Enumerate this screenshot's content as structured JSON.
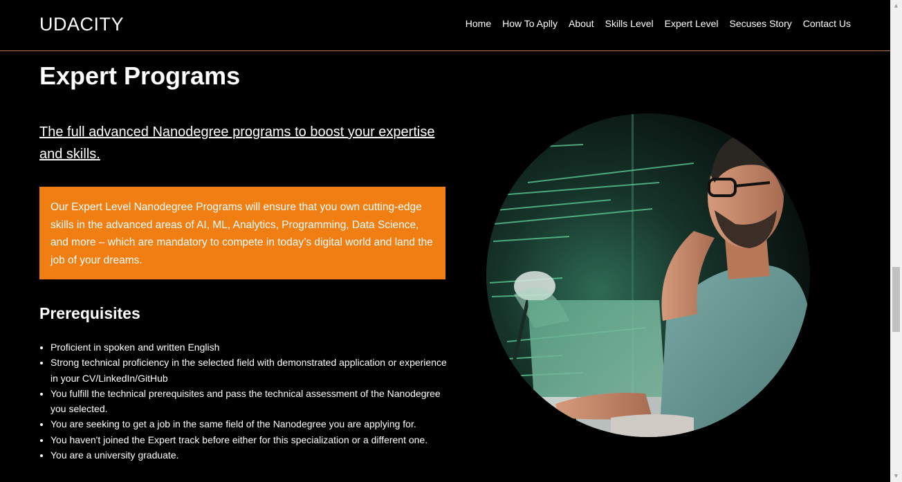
{
  "header": {
    "brand": "UDACITY",
    "nav": [
      "Home",
      "How To Aplly",
      "About",
      "Skills Level",
      "Expert Level",
      "Secuses Story",
      "Contact Us"
    ]
  },
  "main": {
    "title": "Expert Programs",
    "subtitle": "The full advanced Nanodegree programs to boost your expertise and skills.",
    "callout": "Our Expert Level Nanodegree Programs will ensure that you own cutting-edge skills in the advanced areas of AI, ML, Analytics, Programming, Data Science, and more – which are mandatory to compete in today’s digital world and land the job of your dreams.",
    "prerequisites_title": "Prerequisites",
    "prerequisites": [
      "Proficient in spoken and written English",
      "Strong technical proficiency in the selected field with demonstrated application or experience in your CV/LinkedIn/GitHub",
      "You fulfill the technical prerequisites and pass the technical assessment of the Nanodegree you selected.",
      "You are seeking to get a job in the same field of the Nanodegree you are applying for.",
      "You haven't joined the Expert track before either for this specialization or a different one.",
      "You are a university graduate."
    ]
  },
  "hero": {
    "icon": "developer-at-laptop-photo"
  },
  "colors": {
    "background": "#000000",
    "accent": "#f07e12",
    "divider": "#c07a52"
  }
}
